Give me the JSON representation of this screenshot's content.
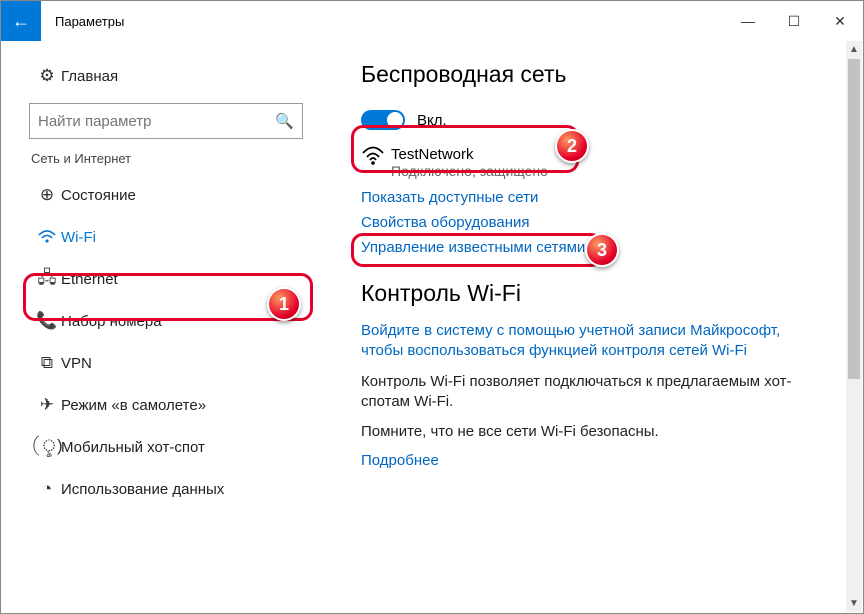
{
  "window": {
    "title": "Параметры",
    "minimize": "—",
    "maximize": "☐",
    "close": "✕",
    "back": "←"
  },
  "sidebar": {
    "home": "Главная",
    "search_placeholder": "Найти параметр",
    "category": "Сеть и Интернет",
    "items": [
      {
        "icon": "⊕",
        "label": "Состояние"
      },
      {
        "icon": "⚋",
        "label": "Wi-Fi"
      },
      {
        "icon": "🖧",
        "label": "Ethernet"
      },
      {
        "icon": "📞",
        "label": "Набор номера"
      },
      {
        "icon": "⧉",
        "label": "VPN"
      },
      {
        "icon": "✈",
        "label": "Режим «в самолете»"
      },
      {
        "icon": "(ৢ)",
        "label": "Мобильный хот-спот"
      },
      {
        "icon": "◔",
        "label": "Использование данных"
      }
    ]
  },
  "main": {
    "h1": "Беспроводная сеть",
    "toggle_label": "Вкл.",
    "network_name": "TestNetwork",
    "network_status": "Подключено, защищено",
    "link_show": "Показать доступные сети",
    "link_props": "Свойства оборудования",
    "link_known": "Управление известными сетями",
    "h2": "Контроль Wi-Fi",
    "link_signin": "Войдите в систему с помощью учетной записи Майкрософт, чтобы воспользоваться функцией контроля сетей Wi-Fi",
    "para1": "Контроль Wi-Fi позволяет подключаться к предлагаемым хот-спотам Wi-Fi.",
    "para2": "Помните, что не все сети Wi-Fi безопасны.",
    "link_more": "Подробнее"
  },
  "annotations": {
    "b1": "1",
    "b2": "2",
    "b3": "3"
  }
}
